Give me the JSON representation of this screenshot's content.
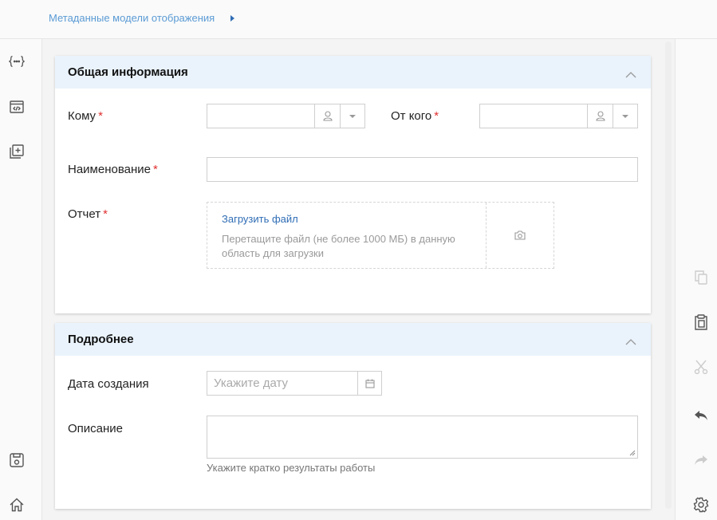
{
  "breadcrumb": {
    "label": "Метаданные модели отображения"
  },
  "left_toolbar": {
    "items": [
      "code-braces-icon",
      "code-window-icon",
      "add-copy-icon"
    ],
    "bottom": [
      "save-icon",
      "home-icon"
    ]
  },
  "right_toolbar": {
    "items": [
      {
        "icon": "copy-icon",
        "enabled": false
      },
      {
        "icon": "paste-icon",
        "enabled": true
      },
      {
        "icon": "cut-icon",
        "enabled": false
      },
      {
        "icon": "undo-icon",
        "enabled": true
      },
      {
        "icon": "redo-icon",
        "enabled": false
      },
      {
        "icon": "gear-icon",
        "enabled": true
      }
    ]
  },
  "section_general": {
    "title": "Общая информация",
    "to_label": "Кому",
    "from_label": "От кого",
    "name_label": "Наименование",
    "report_label": "Отчет",
    "required_mark": "*",
    "upload_link": "Загрузить файл",
    "upload_hint": "Перетащите файл (не более 1000 МБ) в данную область для загрузки",
    "to_value": "",
    "from_value": "",
    "name_value": ""
  },
  "section_details": {
    "title": "Подробнее",
    "date_label": "Дата создания",
    "date_placeholder": "Укажите дату",
    "description_label": "Описание",
    "description_hint": "Укажите кратко результаты работы",
    "description_value": ""
  },
  "colors": {
    "accent": "#2f6db5",
    "breadcrumb": "#5b9bd5",
    "header_bg": "#eaf3fc",
    "required": "#e03030",
    "icon_enabled": "#555555",
    "icon_disabled": "#cccccc"
  }
}
